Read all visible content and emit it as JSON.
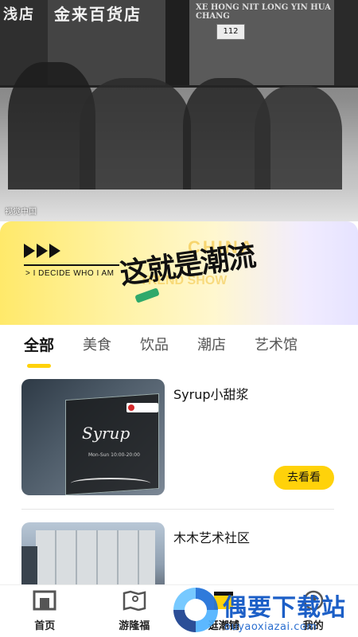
{
  "hero": {
    "sign_left": "浅店",
    "sign_mid": "金来百货店",
    "sign_right": "XE HONG NIT LONG YIN HUA CHANG",
    "plate": "112",
    "credit": "视觉中国"
  },
  "banner": {
    "tagline": "> I DECIDE WHO I AM",
    "calligraphy": "这就是潮流",
    "ghost_text_1": "CHINA",
    "ghost_text_2": "TREND SHOW"
  },
  "tabs": [
    {
      "label": "全部",
      "active": true
    },
    {
      "label": "美食",
      "active": false
    },
    {
      "label": "饮品",
      "active": false
    },
    {
      "label": "潮店",
      "active": false
    },
    {
      "label": "艺术馆",
      "active": false
    }
  ],
  "cards": [
    {
      "name": "Syrup小甜浆",
      "button": "去看看",
      "thumb_script": "Syrup",
      "thumb_hours": "Mon-Sun 10:00-20:00"
    },
    {
      "name": "木木艺术社区"
    }
  ],
  "nav": [
    {
      "label": "首页",
      "icon": "home-icon"
    },
    {
      "label": "游隆福",
      "icon": "map-icon"
    },
    {
      "label": "逛潮铺",
      "icon": "shop-icon",
      "active": true
    },
    {
      "label": "我的",
      "icon": "profile-icon"
    }
  ],
  "watermark": {
    "title": "偶要下载站",
    "url": "ouyaoxiazai.com"
  },
  "colors": {
    "accent": "#ffd20a",
    "banner_start": "#ffe96a",
    "banner_end": "#e6e3ff"
  }
}
